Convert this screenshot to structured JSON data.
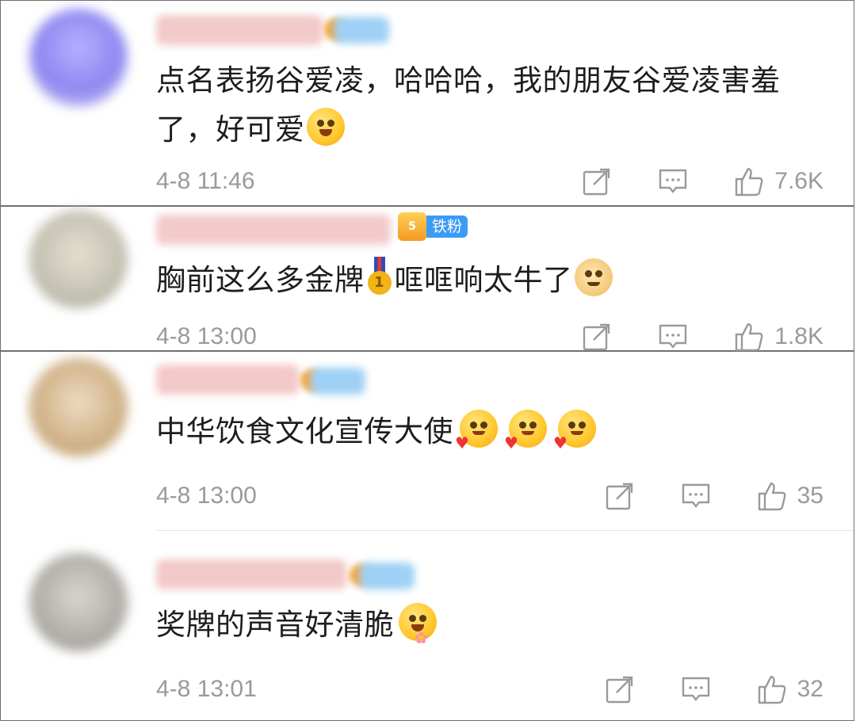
{
  "comments": [
    {
      "text": "点名表扬谷爱凌，哈哈哈，我的朋友谷爱凌害羞了，好可爱",
      "time": "4-8 11:46",
      "likes": "7.6K",
      "emoji": "shy-smile-emoji"
    },
    {
      "text_a": "胸前这么多金牌",
      "text_b": "哐哐响太牛了",
      "badge": "铁粉",
      "badge_level": "5",
      "medal_number": "1",
      "time": "4-8 13:00",
      "likes": "1.8K",
      "emoji": "doge-emoji"
    },
    {
      "text": "中华饮食文化宣传大使",
      "time": "4-8 13:00",
      "likes": "35",
      "emoji": "heart-hug-emoji"
    },
    {
      "text": "奖牌的声音好清脆",
      "time": "4-8 13:01",
      "likes": "32",
      "emoji": "flower-emoji"
    }
  ],
  "colors": {
    "border": "#6f6f6f",
    "meta_gray": "#9a9a9a",
    "badge_blue": "#3b9cf5"
  },
  "icons": [
    "share-icon",
    "comment-icon",
    "like-icon"
  ]
}
